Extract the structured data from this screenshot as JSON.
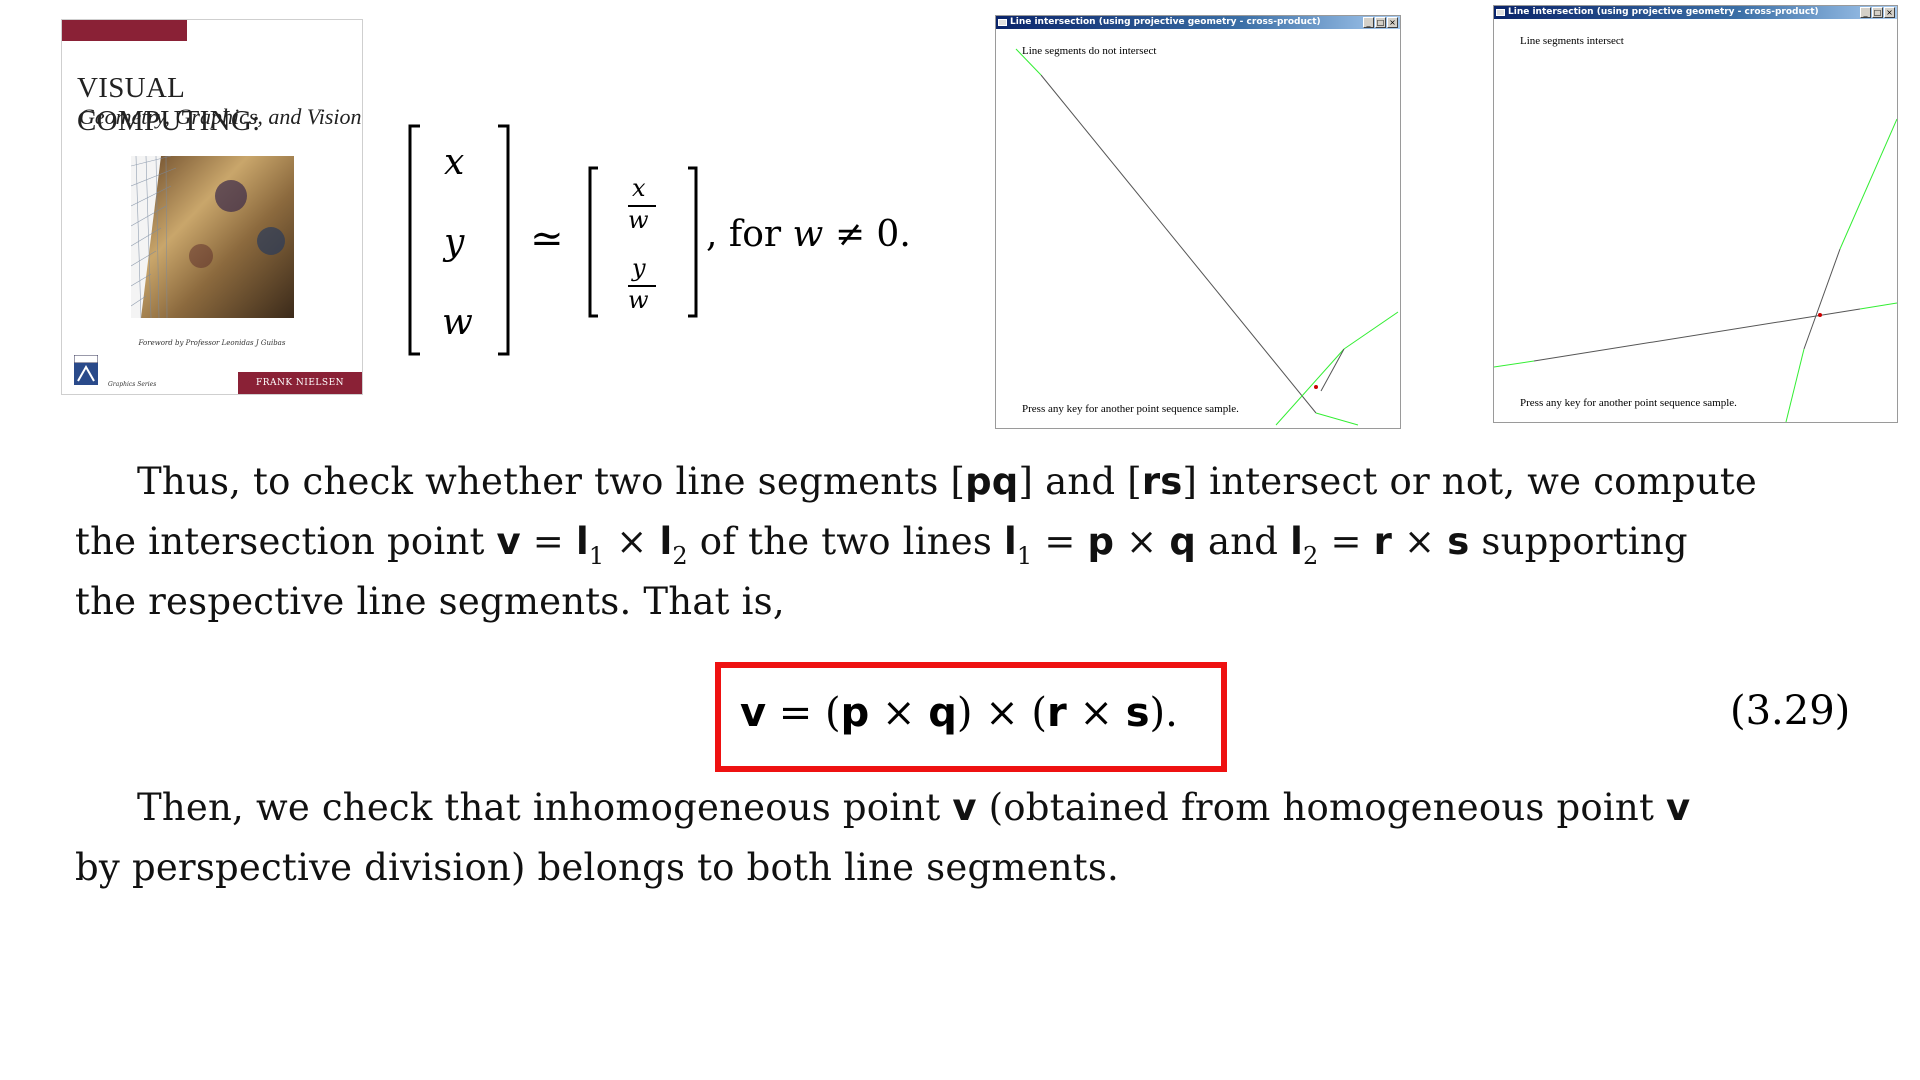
{
  "book_cover": {
    "title_line1": "VISUAL COMPUTING:",
    "title_line2": "Geometry, Graphics, and Vision",
    "foreword": "Foreword by Professor Leonidas J Guibas",
    "series": "Graphics Series",
    "author": "FRANK NIELSEN"
  },
  "equation_projective": {
    "vars": [
      "x",
      "y",
      "w"
    ],
    "similar_symbol": "≃",
    "numerator_x": "x",
    "numerator_y": "y",
    "denominator": "w",
    "condition": ", for ",
    "condition_var": "w",
    "condition_rest": " ≠ 0."
  },
  "window_not_intersect": {
    "title": "Line intersection (using projective geometry - cross-product)",
    "message": "Line segments do not intersect",
    "footer": "Press any key for another point sequence sample."
  },
  "window_intersect": {
    "title": "Line intersection (using projective geometry - cross-product)",
    "message": "Line segments intersect",
    "footer": "Press any key for another point sequence sample."
  },
  "paragraph1": {
    "line1_a": "Thus, to check whether two line segments [",
    "line1_pq": "pq",
    "line1_b": "] and [",
    "line1_rs": "rs",
    "line1_c": "] intersect or not, we compute",
    "line2_a": "the intersection point ",
    "v": "v",
    "eq": " = ",
    "l": "l",
    "sub1": "1",
    "sub2": "2",
    "times": " × ",
    "line2_b": " of the two lines ",
    "p": "p",
    "q": "q",
    "and": " and ",
    "r": "r",
    "s": "s",
    "line2_c": " supporting",
    "line3": "the respective line segments.  That is,"
  },
  "equation_main": {
    "text_v": "v",
    "text_rest_a": " = (",
    "p": "p",
    "q": "q",
    "r": "r",
    "s": "s",
    "times": " × ",
    "close_mid": ") × (",
    "close_end": ").",
    "number": "(3.29)"
  },
  "paragraph2": {
    "line1_a": "Then, we check that inhomogeneous point ",
    "v": "v",
    "line1_b": " (obtained from homogeneous point ",
    "line2": "by perspective division) belongs to both line segments."
  },
  "colors": {
    "accent_maroon": "#8a2136",
    "highlight_red": "#ee1111",
    "segment_green": "#33ee33",
    "segment_gray": "#555555"
  }
}
